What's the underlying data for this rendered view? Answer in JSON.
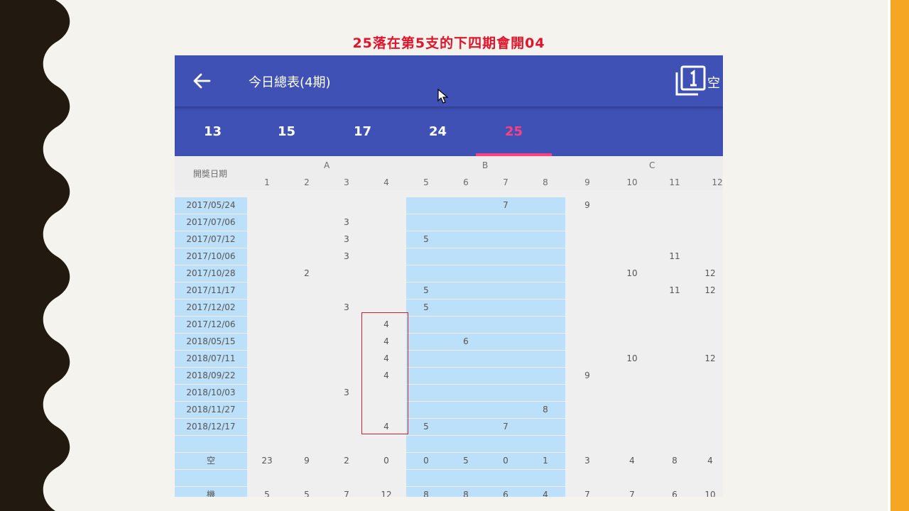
{
  "slide": {
    "title": "25落在第5支的下四期會開04",
    "colors": {
      "title": "#e0142b",
      "left_border": "#221a10",
      "right_stripe": "#f5a623",
      "background": "#f4f3ee"
    }
  },
  "app": {
    "colors": {
      "toolbar": "#3f51b5",
      "accent": "#ff4081",
      "column_highlight": "#bcdffa",
      "box": "#d0202a"
    },
    "toolbar": {
      "back_icon": "arrow-left",
      "title": "今日總表(4期)",
      "copy_icon": "filter-1",
      "copy_label": "空"
    },
    "tabs": [
      "13",
      "15",
      "17",
      "24",
      "25"
    ],
    "active_tab": "25",
    "table": {
      "date_header": "開獎日期",
      "groups": [
        "A",
        "B",
        "C"
      ],
      "columns": [
        "1",
        "2",
        "3",
        "4",
        "5",
        "6",
        "7",
        "8",
        "9",
        "10",
        "11",
        "12"
      ],
      "rows": [
        {
          "date": "2017/05/24",
          "cells": [
            "",
            "",
            "",
            "",
            "",
            "",
            "7",
            "",
            "9",
            "",
            "",
            ""
          ]
        },
        {
          "date": "2017/07/06",
          "cells": [
            "",
            "",
            "3",
            "",
            "",
            "",
            "",
            "",
            "",
            "",
            "",
            ""
          ]
        },
        {
          "date": "2017/07/12",
          "cells": [
            "",
            "",
            "3",
            "",
            "5",
            "",
            "",
            "",
            "",
            "",
            "",
            ""
          ]
        },
        {
          "date": "2017/10/06",
          "cells": [
            "",
            "",
            "3",
            "",
            "",
            "",
            "",
            "",
            "",
            "",
            "11",
            ""
          ]
        },
        {
          "date": "2017/10/28",
          "cells": [
            "",
            "2",
            "",
            "",
            "",
            "",
            "",
            "",
            "",
            "10",
            "",
            "12"
          ]
        },
        {
          "date": "2017/11/17",
          "cells": [
            "",
            "",
            "",
            "",
            "5",
            "",
            "",
            "",
            "",
            "",
            "11",
            "12"
          ]
        },
        {
          "date": "2017/12/02",
          "cells": [
            "",
            "",
            "3",
            "",
            "5",
            "",
            "",
            "",
            "",
            "",
            "",
            ""
          ]
        },
        {
          "date": "2017/12/06",
          "cells": [
            "",
            "",
            "",
            "4",
            "",
            "",
            "",
            "",
            "",
            "",
            "",
            ""
          ]
        },
        {
          "date": "2018/05/15",
          "cells": [
            "",
            "",
            "",
            "4",
            "",
            "6",
            "",
            "",
            "",
            "",
            "",
            ""
          ]
        },
        {
          "date": "2018/07/11",
          "cells": [
            "",
            "",
            "",
            "4",
            "",
            "",
            "",
            "",
            "",
            "10",
            "",
            "12"
          ]
        },
        {
          "date": "2018/09/22",
          "cells": [
            "",
            "",
            "",
            "4",
            "",
            "",
            "",
            "",
            "9",
            "",
            "",
            ""
          ]
        },
        {
          "date": "2018/10/03",
          "cells": [
            "",
            "",
            "3",
            "",
            "",
            "",
            "",
            "",
            "",
            "",
            "",
            ""
          ]
        },
        {
          "date": "2018/11/27",
          "cells": [
            "",
            "",
            "",
            "",
            "",
            "",
            "",
            "8",
            "",
            "",
            "",
            ""
          ]
        },
        {
          "date": "2018/12/17",
          "cells": [
            "",
            "",
            "",
            "4",
            "5",
            "",
            "7",
            "",
            "",
            "",
            "",
            ""
          ]
        },
        {
          "date": "",
          "cells": [
            "",
            "",
            "",
            "",
            "",
            "",
            "",
            "",
            "",
            "",
            "",
            ""
          ]
        },
        {
          "date": "空",
          "cells": [
            "23",
            "9",
            "2",
            "0",
            "0",
            "5",
            "0",
            "1",
            "3",
            "4",
            "8",
            "4"
          ]
        },
        {
          "date": "",
          "cells": [
            "",
            "",
            "",
            "",
            "",
            "",
            "",
            "",
            "",
            "",
            "",
            ""
          ]
        },
        {
          "date": "機",
          "cells": [
            "5",
            "5",
            "7",
            "12",
            "8",
            "8",
            "6",
            "4",
            "7",
            "7",
            "6",
            "10"
          ]
        }
      ]
    }
  }
}
